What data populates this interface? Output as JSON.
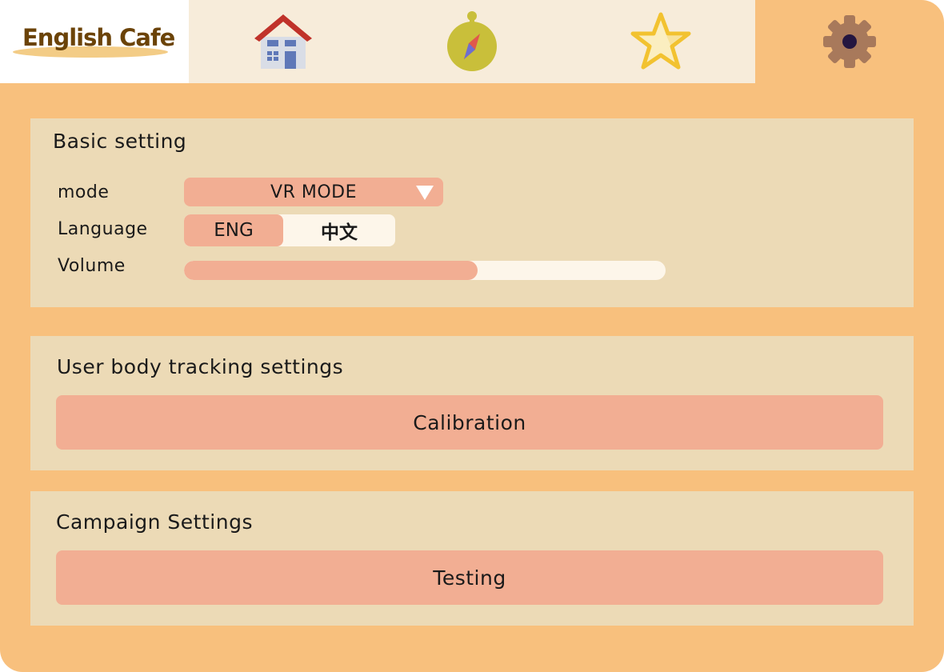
{
  "app": {
    "logo_text": "English Cafe"
  },
  "nav": {
    "icons": [
      "home-icon",
      "compass-icon",
      "star-icon",
      "gear-icon"
    ],
    "active": "gear-icon"
  },
  "colors": {
    "background": "#f8c07d",
    "panel": "#ecdab6",
    "accent": "#f2ae93",
    "nav_bar": "#f7ecda",
    "light": "#fdf6ea"
  },
  "basic": {
    "title": "Basic setting",
    "mode_label": "mode",
    "mode_value": "VR MODE",
    "language_label": "Language",
    "language_options": [
      "ENG",
      "中文"
    ],
    "language_selected": "ENG",
    "volume_label": "Volume",
    "volume_level": 0.61
  },
  "tracking": {
    "title": "User body tracking settings",
    "calibration_label": "Calibration"
  },
  "campaign": {
    "title": "Campaign Settings",
    "testing_label": "Testing"
  }
}
